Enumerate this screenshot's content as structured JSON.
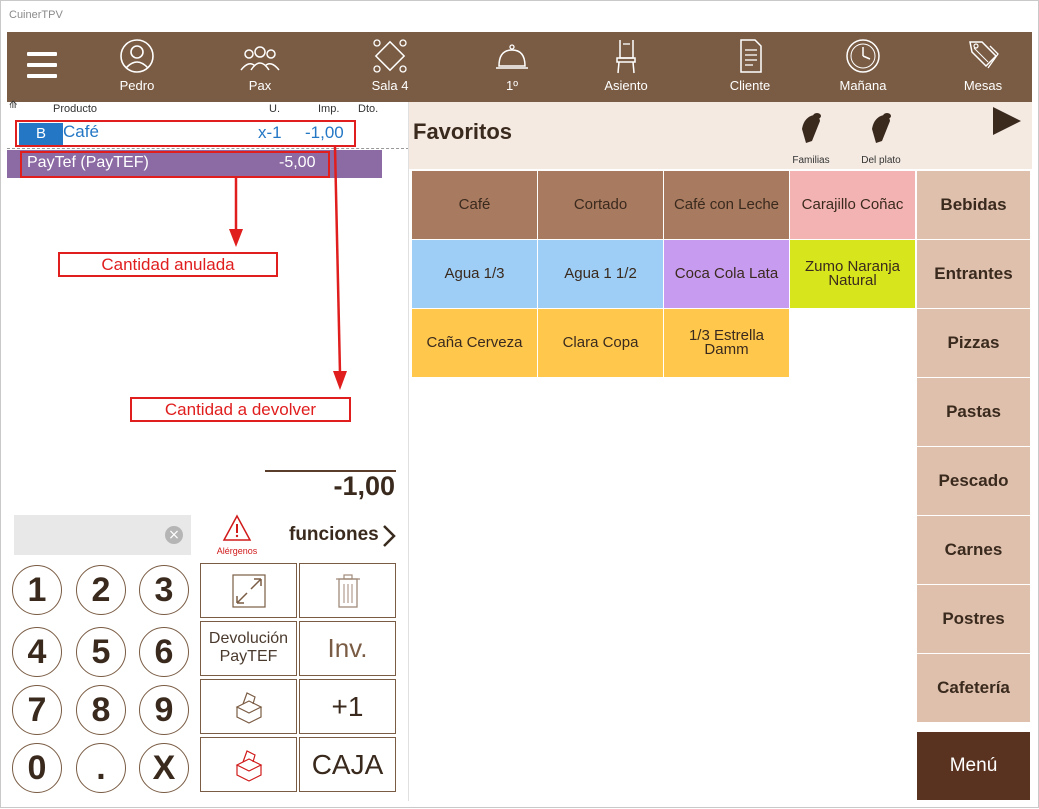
{
  "window": {
    "title": "CuinerTPV"
  },
  "topbar": {
    "items": [
      {
        "label": "Pedro",
        "icon": "user-icon"
      },
      {
        "label": "Pax",
        "icon": "people-icon"
      },
      {
        "label": "Sala 4",
        "icon": "room-icon"
      },
      {
        "label": "1º",
        "icon": "cloche-icon"
      },
      {
        "label": "Asiento",
        "icon": "chair-icon"
      },
      {
        "label": "Cliente",
        "icon": "document-icon"
      },
      {
        "label": "Mañana",
        "icon": "clock-icon"
      },
      {
        "label": "Mesas",
        "icon": "tags-icon"
      }
    ]
  },
  "ticket": {
    "headers": {
      "producto": "Producto",
      "u": "U.",
      "imp": "Imp.",
      "dto": "Dto."
    },
    "lines": [
      {
        "badge": "B",
        "name": "Café",
        "units": "x-1",
        "amount": "-1,00"
      },
      {
        "name": "PayTef (PayTEF)",
        "amount": "-5,00"
      }
    ],
    "total": "-1,00"
  },
  "annotations": {
    "cantidad_anulada": "Cantidad anulada",
    "cantidad_devolver": "Cantidad a devolver"
  },
  "controls": {
    "search_clear": "×",
    "alergenos": "Alérgenos",
    "funciones": "funciones",
    "numpad": [
      "1",
      "2",
      "3",
      "4",
      "5",
      "6",
      "7",
      "8",
      "9",
      "0",
      ".",
      "X"
    ],
    "function_keys": {
      "devolucion": "Devolución PayTEF",
      "inv": "Inv.",
      "plus_one": "+1",
      "caja": "CAJA"
    }
  },
  "favoritos": {
    "title": "Favoritos",
    "filters": [
      {
        "label": "Familias"
      },
      {
        "label": "Del plato"
      }
    ],
    "products": [
      {
        "label": "Café",
        "color": "#a87a5f"
      },
      {
        "label": "Cortado",
        "color": "#a87a5f"
      },
      {
        "label": "Café con Leche",
        "color": "#a87a5f"
      },
      {
        "label": "Carajillo Coñac",
        "color": "#f4b3b3"
      },
      {
        "label": "Agua 1/3",
        "color": "#9ecdf5"
      },
      {
        "label": "Agua 1 1/2",
        "color": "#9ecdf5"
      },
      {
        "label": "Coca Cola Lata",
        "color": "#c79cf0"
      },
      {
        "label": "Zumo Naranja Natural",
        "color": "#d7e51c"
      },
      {
        "label": "Caña Cerveza",
        "color": "#ffc84d"
      },
      {
        "label": "Clara Copa",
        "color": "#ffc84d"
      },
      {
        "label": "1/3 Estrella Damm",
        "color": "#ffc84d"
      }
    ]
  },
  "categories": [
    "Bebidas",
    "Entrantes",
    "Pizzas",
    "Pastas",
    "Pescado",
    "Carnes",
    "Postres",
    "Cafetería"
  ],
  "menu_label": "Menú"
}
